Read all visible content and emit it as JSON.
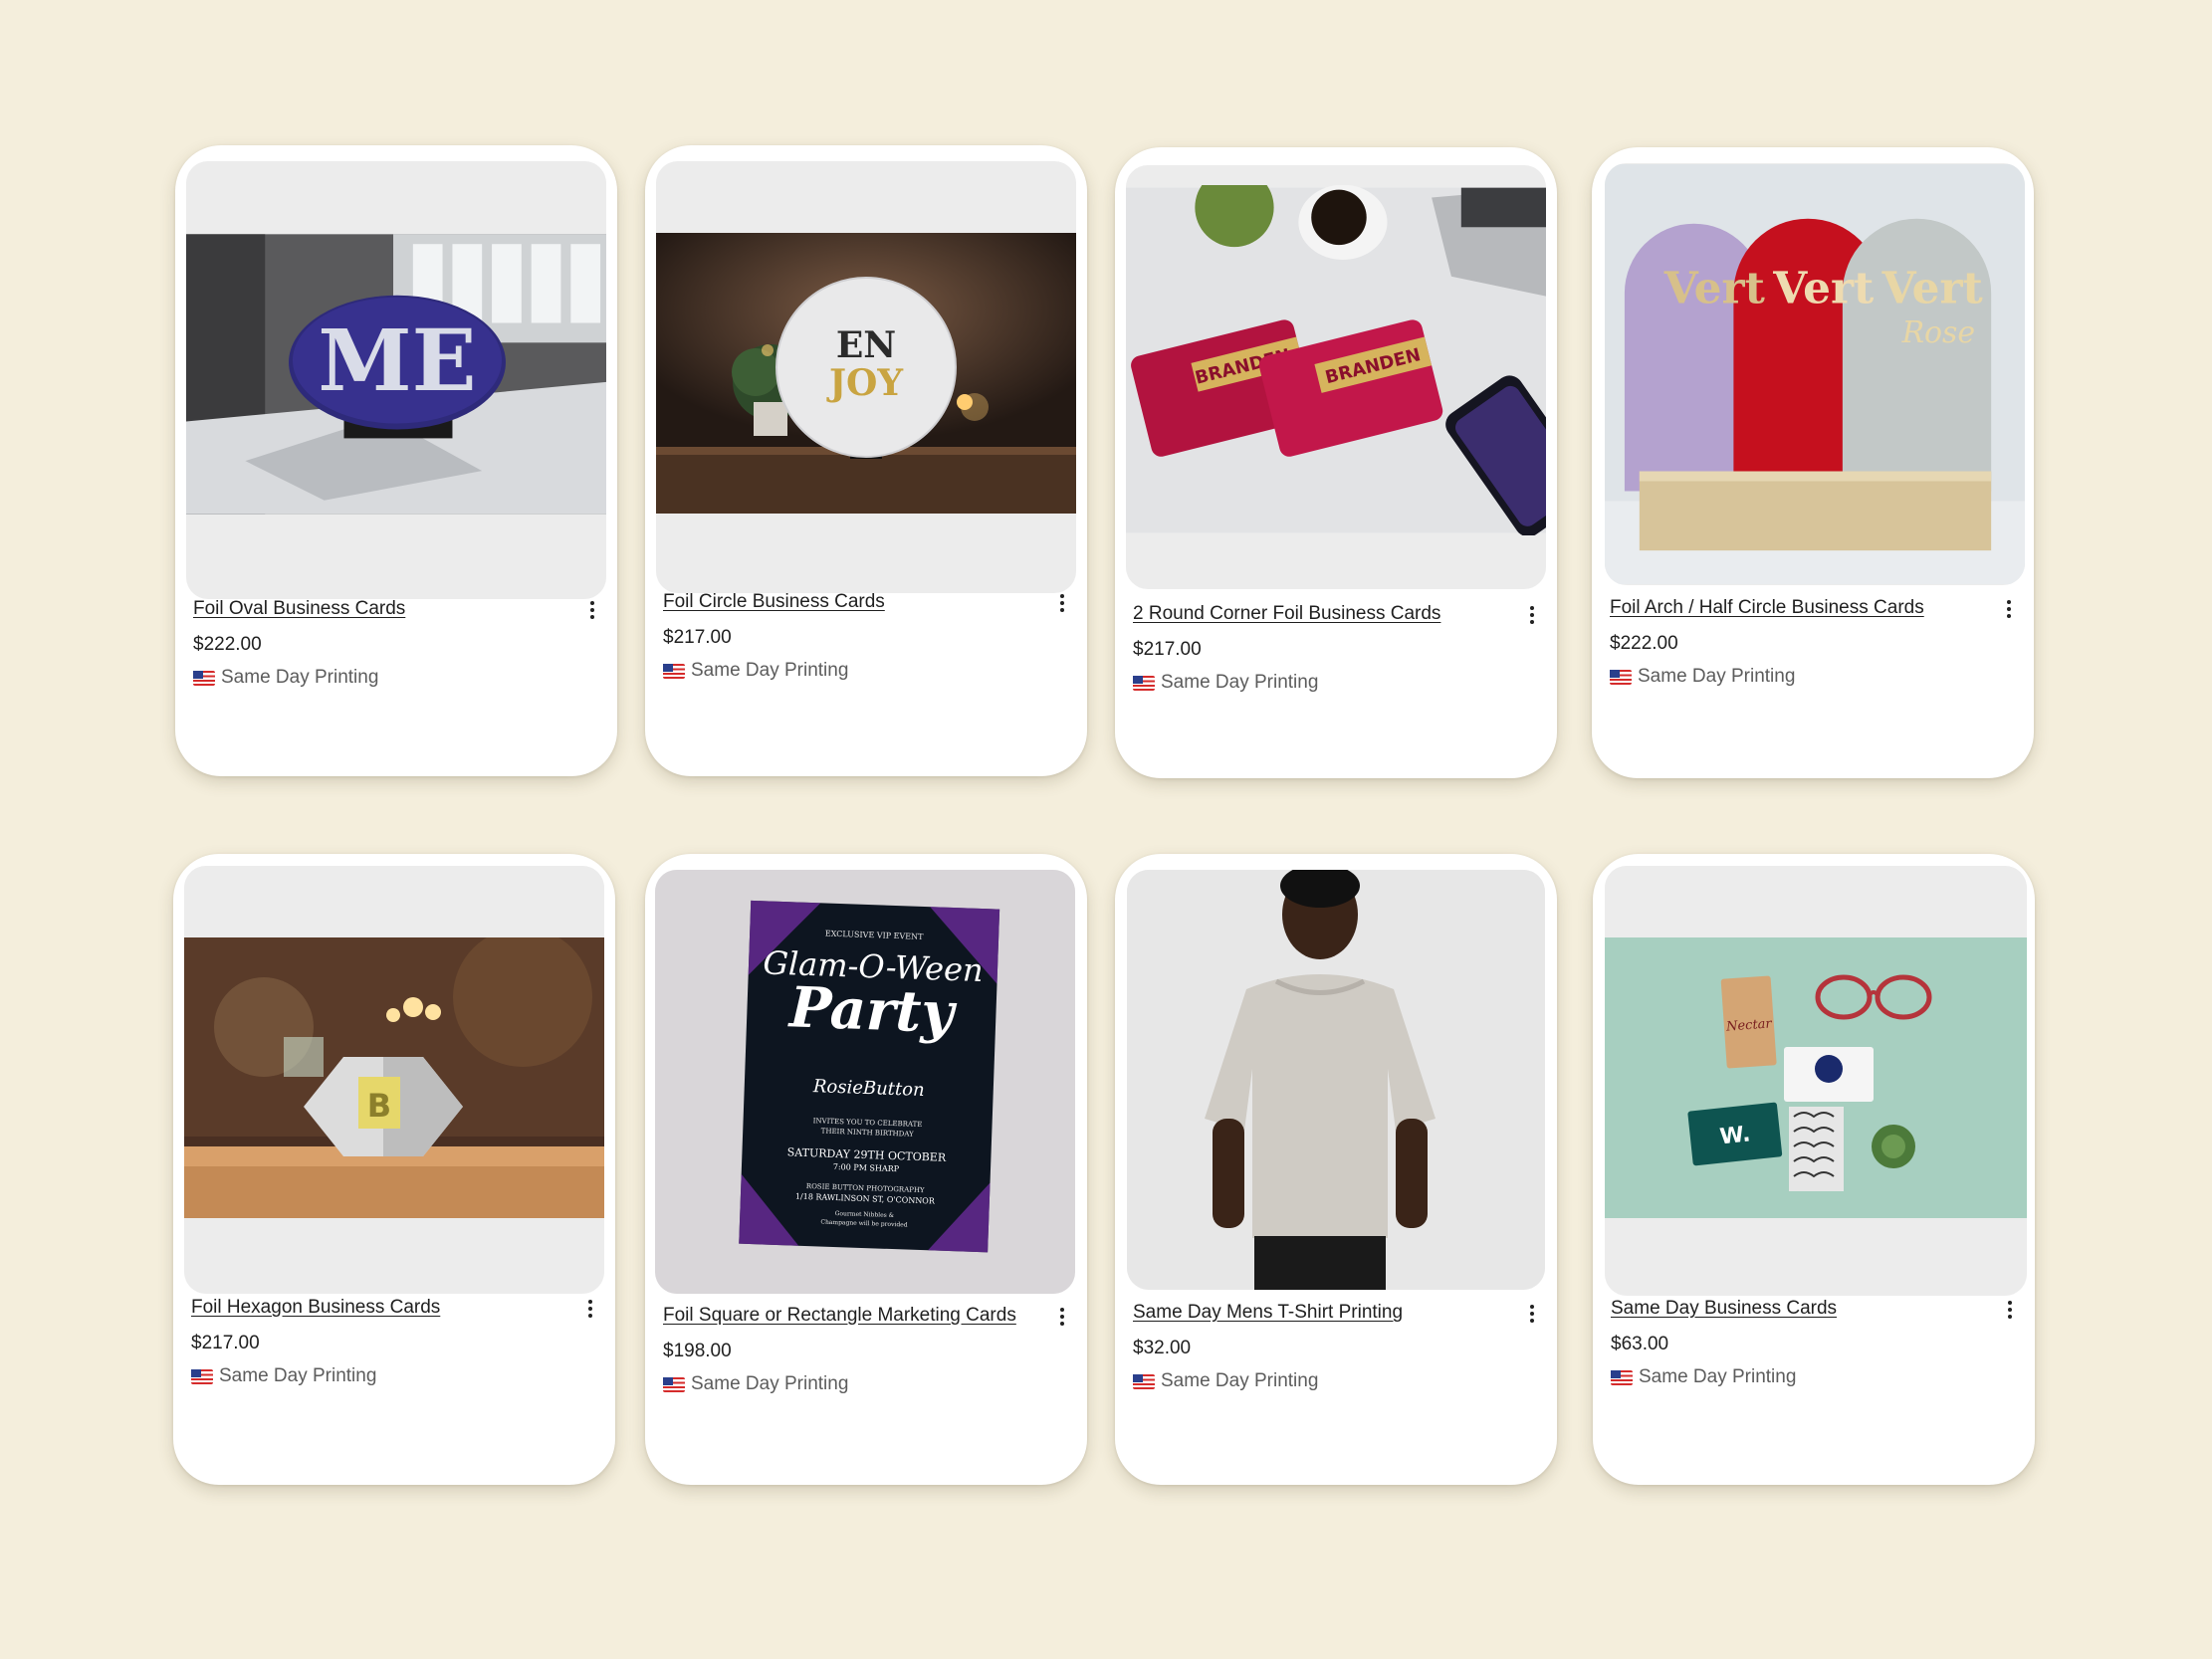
{
  "products": [
    {
      "title": "Foil Oval Business Cards",
      "price": "$222.00",
      "seller": "Same Day Printing",
      "image": "purple-oval-foil-sign-on-desk"
    },
    {
      "title": "Foil Circle Business Cards",
      "price": "$217.00",
      "seller": "Same Day Printing",
      "image": "white-round-foil-card-on-table"
    },
    {
      "title": "2 Round Corner Foil Business Cards",
      "price": "$217.00",
      "seller": "Same Day Printing",
      "image": "red-foil-business-cards-with-laptop",
      "brand_text": "BRANDEN"
    },
    {
      "title": "Foil Arch / Half Circle Business Cards",
      "price": "$222.00",
      "seller": "Same Day Printing",
      "image": "arch-shaped-foil-cards-on-wood-block",
      "brand_text": "Vert Rose"
    },
    {
      "title": "Foil Hexagon Business Cards",
      "price": "$217.00",
      "seller": "Same Day Printing",
      "image": "hexagon-foil-card-on-wooden-table",
      "brand_text": "B"
    },
    {
      "title": "Foil Square or Rectangle Marketing Cards",
      "price": "$198.00",
      "seller": "Same Day Printing",
      "image": "glam-o-ween-party-invitation",
      "invite": {
        "eyebrow": "EXCLUSIVE VIP EVENT",
        "line1": "Glam-O-Ween",
        "line2": "Party",
        "host": "RosieButton",
        "invites": "INVITES YOU TO CELEBRATE",
        "invites2": "THEIR NINTH BIRTHDAY",
        "date": "SATURDAY 29TH OCTOBER",
        "time": "7:00 PM SHARP",
        "venue": "ROSIE BUTTON PHOTOGRAPHY",
        "address": "1/18 RAWLINSON ST, O'CONNOR",
        "note": "Gourmet Nibbles &",
        "note2": "Champagne will be provided"
      }
    },
    {
      "title": "Same Day Mens T-Shirt Printing",
      "price": "$32.00",
      "seller": "Same Day Printing",
      "image": "man-in-plain-grey-t-shirt"
    },
    {
      "title": "Same Day Business Cards",
      "price": "$63.00",
      "seller": "Same Day Printing",
      "image": "business-cards-flatlay-with-glasses",
      "brand_text": "Nectar"
    }
  ],
  "colors": {
    "background": "#f4eedc",
    "card": "#ffffff",
    "image_placeholder": "#ececec",
    "title_text": "#1f1f1f",
    "seller_text": "#5c5c5c"
  },
  "icons": {
    "seller_flag": "flag-icon",
    "card_menu": "more-vert-icon"
  }
}
